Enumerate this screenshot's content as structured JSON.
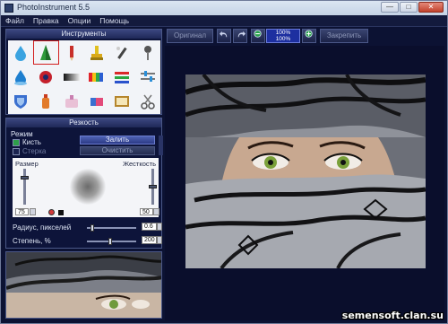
{
  "window": {
    "title": "PhotoInstrument 5.5"
  },
  "menu": [
    "Файл",
    "Правка",
    "Опции",
    "Помощь"
  ],
  "tools_panel": {
    "title": "Инструменты",
    "icons": [
      "water-drop-icon",
      "cone-icon",
      "pencil-icon",
      "stamp-icon",
      "wand-icon",
      "pin-icon",
      "liquid-drop-icon",
      "record-icon",
      "gradient-icon",
      "palette-icon",
      "rgb-bars-icon",
      "sliders-icon",
      "shield-icon",
      "bottle-icon",
      "sponge-icon",
      "eraser-icon",
      "clock-icon",
      "scissors-icon"
    ],
    "active_index": 1
  },
  "sharpness_panel": {
    "title": "Резкость",
    "mode_label": "Режим",
    "brush_label": "Кисть",
    "eraser_label": "Стерка",
    "fill_button": "Залить",
    "clear_button": "Очистить",
    "size_label": "Размер",
    "hardness_label": "Жесткость",
    "size_value": "75",
    "hardness_value": "50",
    "radius_label": "Радиус, пикселей",
    "radius_value": "0.6",
    "degree_label": "Степень, %",
    "degree_value": "200"
  },
  "toolbar": {
    "original": "Оригинал",
    "zoom_top": "100%",
    "zoom_bottom": "100%",
    "fix": "Закрепить"
  },
  "watermark": "semensoft.clan.su",
  "colors": {
    "accent": "#2c3a86",
    "active_tool_border": "#d21d1d",
    "background": "#0c1233"
  }
}
